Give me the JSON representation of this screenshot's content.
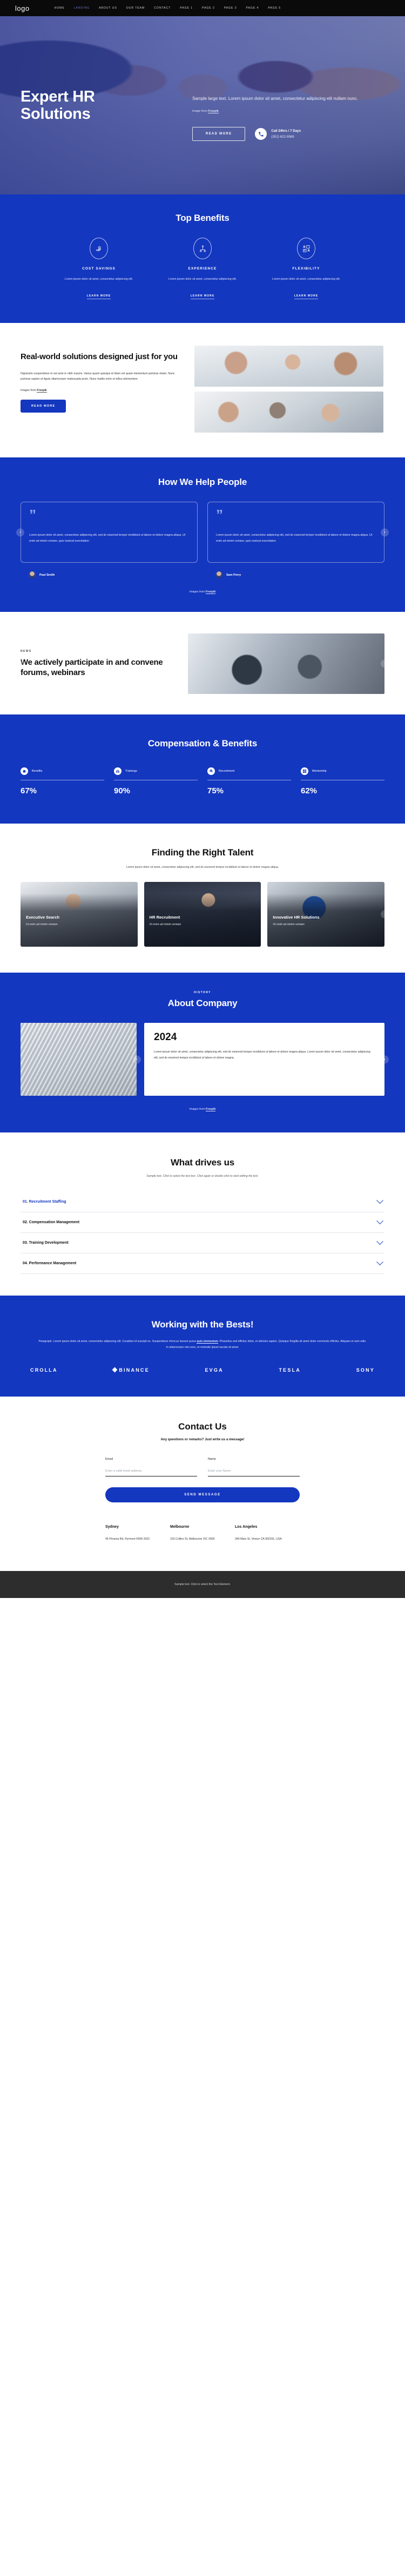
{
  "nav": {
    "logo": "logo",
    "links": [
      {
        "label": "HOME",
        "active": false
      },
      {
        "label": "LANDING",
        "active": true
      },
      {
        "label": "ABOUT US",
        "active": false
      },
      {
        "label": "OUR TEAM",
        "active": false
      },
      {
        "label": "CONTACT",
        "active": false
      },
      {
        "label": "PAGE 1",
        "active": false
      },
      {
        "label": "PAGE 2",
        "active": false
      },
      {
        "label": "PAGE 3",
        "active": false
      },
      {
        "label": "PAGE 4",
        "active": false
      },
      {
        "label": "PAGE 5",
        "active": false
      }
    ]
  },
  "hero": {
    "title_line1": "Expert HR",
    "title_line2": "Solutions",
    "subtitle": "Sample large text. Lorem ipsum dolor sit amet, consectetur adipiscing elit nullam nunc.",
    "credit_prefix": "Image from ",
    "credit_link": "Freepik",
    "cta_label": "READ MORE",
    "call_title": "Call 24hrs / 7 Days",
    "call_number": "(352) 622-9969"
  },
  "benefits": {
    "title": "Top Benefits",
    "items": [
      {
        "icon": "money-hand-icon",
        "title": "COST SAVINGS",
        "desc": "Lorem ipsum dolor sit amet, consectetur adipiscing elit.",
        "link": "LEARN MORE"
      },
      {
        "icon": "org-chart-icon",
        "title": "EXPERIENCE",
        "desc": "Lorem ipsum dolor sit amet, consectetur adipiscing elit.",
        "link": "LEARN MORE"
      },
      {
        "icon": "people-cards-icon",
        "title": "FLEXIBILITY",
        "desc": "Lorem ipsum dolor sit amet, consectetur adipiscing elit.",
        "link": "LEARN MORE"
      }
    ]
  },
  "realworld": {
    "title": "Real-world solutions designed just for you",
    "paragraph": "Dignissim suspendisse in est ante in nibh mauris. Varius quam quisque id diam vel quam elementum pulvinar etiam. Nunc pulvinar sapien et ligula ullamcorper malesuada proin. Nunc mattis enim ut tellus elementum.",
    "credit_prefix": "Images from ",
    "credit_link": "Freepik",
    "cta_label": "READ MORE"
  },
  "testimonials": {
    "title": "How We Help People",
    "cards": [
      {
        "quote": "Lorem ipsum dolor sit amet, consectetur adipiscing elit, sed do eiusmod tempor incididunt ut labore et dolore magna aliqua. Ut enim ad minim veniam, quis nostrud exercitation",
        "name": "Paul Smith"
      },
      {
        "quote": "Lorem ipsum dolor sit amet, consectetur adipiscing elit, sed do eiusmod tempor incididunt ut labore et dolore magna aliqua. Ut enim ad minim veniam, quis nostrud exercitation",
        "name": "Sam Perry"
      }
    ],
    "prev": "‹",
    "next": "›",
    "credit_prefix": "Images from ",
    "credit_link": "Freepik"
  },
  "forums": {
    "tag": "NEWS",
    "title": "We actively participate in and convene forums, webinars",
    "prev": "‹",
    "next": "›"
  },
  "stats": {
    "title": "Compensation & Benefits",
    "items": [
      {
        "icon": "briefcase-icon",
        "label": "Benefits",
        "value": "67%"
      },
      {
        "icon": "group-icon",
        "label": "Trainings",
        "value": "90%"
      },
      {
        "icon": "search-person-icon",
        "label": "Recruitment",
        "value": "75%"
      },
      {
        "icon": "mentorship-icon",
        "label": "Mentorship",
        "value": "62%"
      }
    ]
  },
  "talent": {
    "title": "Finding the Right Talent",
    "subtitle": "Lorem ipsum dolor sit amet, consectetur adipiscing elit, sed do eiusmod tempor incididunt ut labore et dolore magna aliqua.",
    "prev": "‹",
    "next": "›",
    "cards": [
      {
        "title": "Executive Search",
        "desc": "Ut enim ad minim veniam"
      },
      {
        "title": "HR Recruitment",
        "desc": "Ut enim ad minim veniam"
      },
      {
        "title": "Innovative HR Solutions",
        "desc": "Ut enim ad minim veniam"
      }
    ]
  },
  "about": {
    "eyebrow": "HISTORY",
    "title": "About Company",
    "year": "2024",
    "paragraph": "Lorem ipsum dolor sit amet, consectetur adipiscing elit, sed do eiusmod tempor incididunt ut labore et dolore magna aliqua. Lorem ipsum dolor sit amet, consectetur adipiscing elit, sed do eiusmod tempor incididunt ut labore et dolore magna.",
    "prev": "‹",
    "next": "›",
    "credit_prefix": "Images from ",
    "credit_link": "Freepik"
  },
  "accordion": {
    "title": "What drives us",
    "subtitle": "Sample text. Click to select the text box. Click again or double click to start editing the text.",
    "items": [
      {
        "label": "01. Recruitment Staffing",
        "active": true
      },
      {
        "label": "02. Compensation Management",
        "active": false
      },
      {
        "label": "03. Training Development",
        "active": false
      },
      {
        "label": "04. Performance Management",
        "active": false
      }
    ]
  },
  "brands": {
    "title": "Working with the Bests!",
    "paragraph_1": "Paragraph. Lorem ipsum dolor sit amet, consectetur adipiscing elit. Curabitur id suscipit ex. Suspendisse rhoncus laoreet purus ",
    "paragraph_link": "quis elementum",
    "paragraph_2": ". Phasellus sed efficitur dolor, et ultricies sapien. Quisque fringilla sit amet dolor commodo efficitur. Aliquam et sem odio. In ullamcorper nisi nunc, et molestie ipsum iaculis sit amet.",
    "logos": [
      "CROLLA",
      "BINANCE",
      "EVGA",
      "TESLA",
      "SONY"
    ]
  },
  "contact": {
    "title": "Contact Us",
    "subtitle": "Any questions or remarks? Just write us a message!",
    "email_label": "Email",
    "email_placeholder": "Enter a valid email address",
    "email_value": "",
    "name_label": "Name",
    "name_placeholder": "Enter your Name",
    "name_value": "",
    "send_label": "SEND MESSAGE",
    "offices": [
      {
        "city": "Sydney",
        "address": "45 Pirrama Rd, Pyrmont NSW 2022"
      },
      {
        "city": "Melbourne",
        "address": "163 Collins St, Melbourne VIC 3000"
      },
      {
        "city": "Los Angeles",
        "address": "340 Main St, Venice CA 902291, USA"
      }
    ]
  },
  "footer": {
    "text": "Sample text. Click to select the Text Element."
  }
}
